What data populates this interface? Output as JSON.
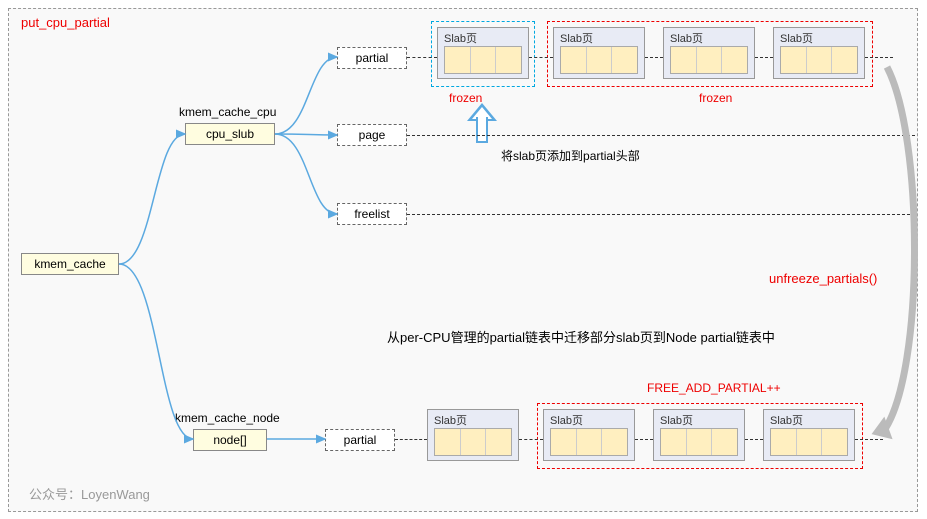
{
  "title": "put_cpu_partial",
  "watermark": "公众号：LoyenWang",
  "nodes": {
    "kmem_cache": "kmem_cache",
    "kmem_cache_cpu_label": "kmem_cache_cpu",
    "cpu_slub": "cpu_slub",
    "kmem_cache_node_label": "kmem_cache_node",
    "node_arr": "node[]",
    "partial": "partial",
    "page": "page",
    "freelist": "freelist"
  },
  "slab_label": "Slab页",
  "labels": {
    "frozen": "frozen",
    "add_head": "将slab页添加到partial头部",
    "unfreeze": "unfreeze_partials()",
    "migrate": "从per-CPU管理的partial链表中迁移部分slab页到Node partial链表中",
    "free_add": "FREE_ADD_PARTIAL++"
  },
  "chart_data": {
    "type": "diagram",
    "title": "put_cpu_partial",
    "root": "kmem_cache",
    "branches": [
      {
        "name": "kmem_cache_cpu",
        "field": "cpu_slub",
        "children": [
          {
            "name": "partial",
            "slabs": 4,
            "slab_label": "Slab页",
            "new_head_frozen": true,
            "existing_frozen": true,
            "note": "将slab页添加到partial头部"
          },
          {
            "name": "page"
          },
          {
            "name": "freelist"
          }
        ]
      },
      {
        "name": "kmem_cache_node",
        "field": "node[]",
        "children": [
          {
            "name": "partial",
            "slabs": 4,
            "slab_label": "Slab页",
            "migrated_group": 3,
            "counter": "FREE_ADD_PARTIAL++"
          }
        ]
      }
    ],
    "action": {
      "name": "unfreeze_partials()",
      "description": "从per-CPU管理的partial链表中迁移部分slab页到Node partial链表中",
      "from": "kmem_cache_cpu.partial",
      "to": "kmem_cache_node.partial"
    }
  }
}
